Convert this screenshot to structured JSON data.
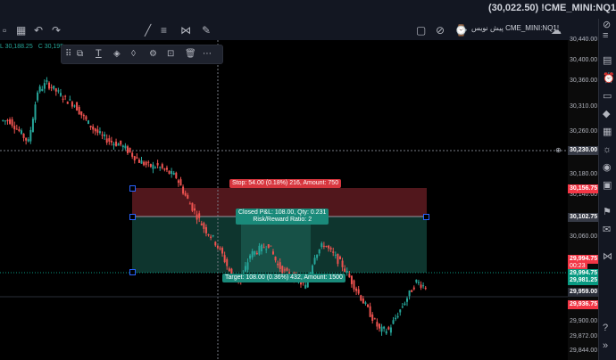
{
  "header": {
    "title": "(30,022.50) !CME_MINI:NQ1",
    "symbol_label": "پیش نویس CME_MINI:NQ1!"
  },
  "legend": {
    "low": "L 30,188.25",
    "close": "C 30,195."
  },
  "price_axis": {
    "ticks": [
      "30,440.00",
      "30,400.00",
      "30,360.00",
      "30,310.00",
      "30,260.00",
      "30,220.00",
      "30,180.00",
      "30,140.00",
      "30,060.00",
      "29,900.00",
      "29,872.00",
      "29,844.00"
    ]
  },
  "price_tags": {
    "crosshair": "30,230.00",
    "stop": "30,156.75",
    "entry": "30,102.75",
    "last_price": "29,994.75",
    "countdown": "00:23",
    "last_price_2": "29,994.75",
    "target": "29,981.25",
    "level_a": "29,959.00",
    "level_b": "29,936.75"
  },
  "position_tool": {
    "stop_label": "Stop: 54.00 (0.18%) 216, Amount: 750",
    "closed_pnl": "Closed P&L: 108.00, Qty: 0.231",
    "risk_reward": "Risk/Reward Ratio: 2",
    "target_label": "Target: 108.00 (0.36%) 432, Amount: 1500"
  },
  "colors": {
    "up": "#26a69a",
    "down": "#ef5350",
    "stop_zone": "#5a1a1f",
    "target_zone": "#0f3b33"
  },
  "chart_data": {
    "type": "candlestick",
    "symbol": "!CME_MINI:NQ1",
    "ylim": [
      29844,
      30440
    ],
    "approx_close_path": [
      30290,
      30270,
      30250,
      30345,
      30360,
      30345,
      30330,
      30320,
      30295,
      30275,
      30260,
      30250,
      30245,
      30230,
      30215,
      30205,
      30205,
      30195,
      30185,
      30150,
      30120,
      30090,
      30070,
      30040,
      30000,
      29990,
      30040,
      30050,
      30060,
      30020,
      30005,
      29995,
      29980,
      30040,
      30060,
      30040,
      30020,
      29990,
      29960,
      29930,
      29900,
      29900,
      29930,
      29960,
      29990,
      29980
    ]
  }
}
